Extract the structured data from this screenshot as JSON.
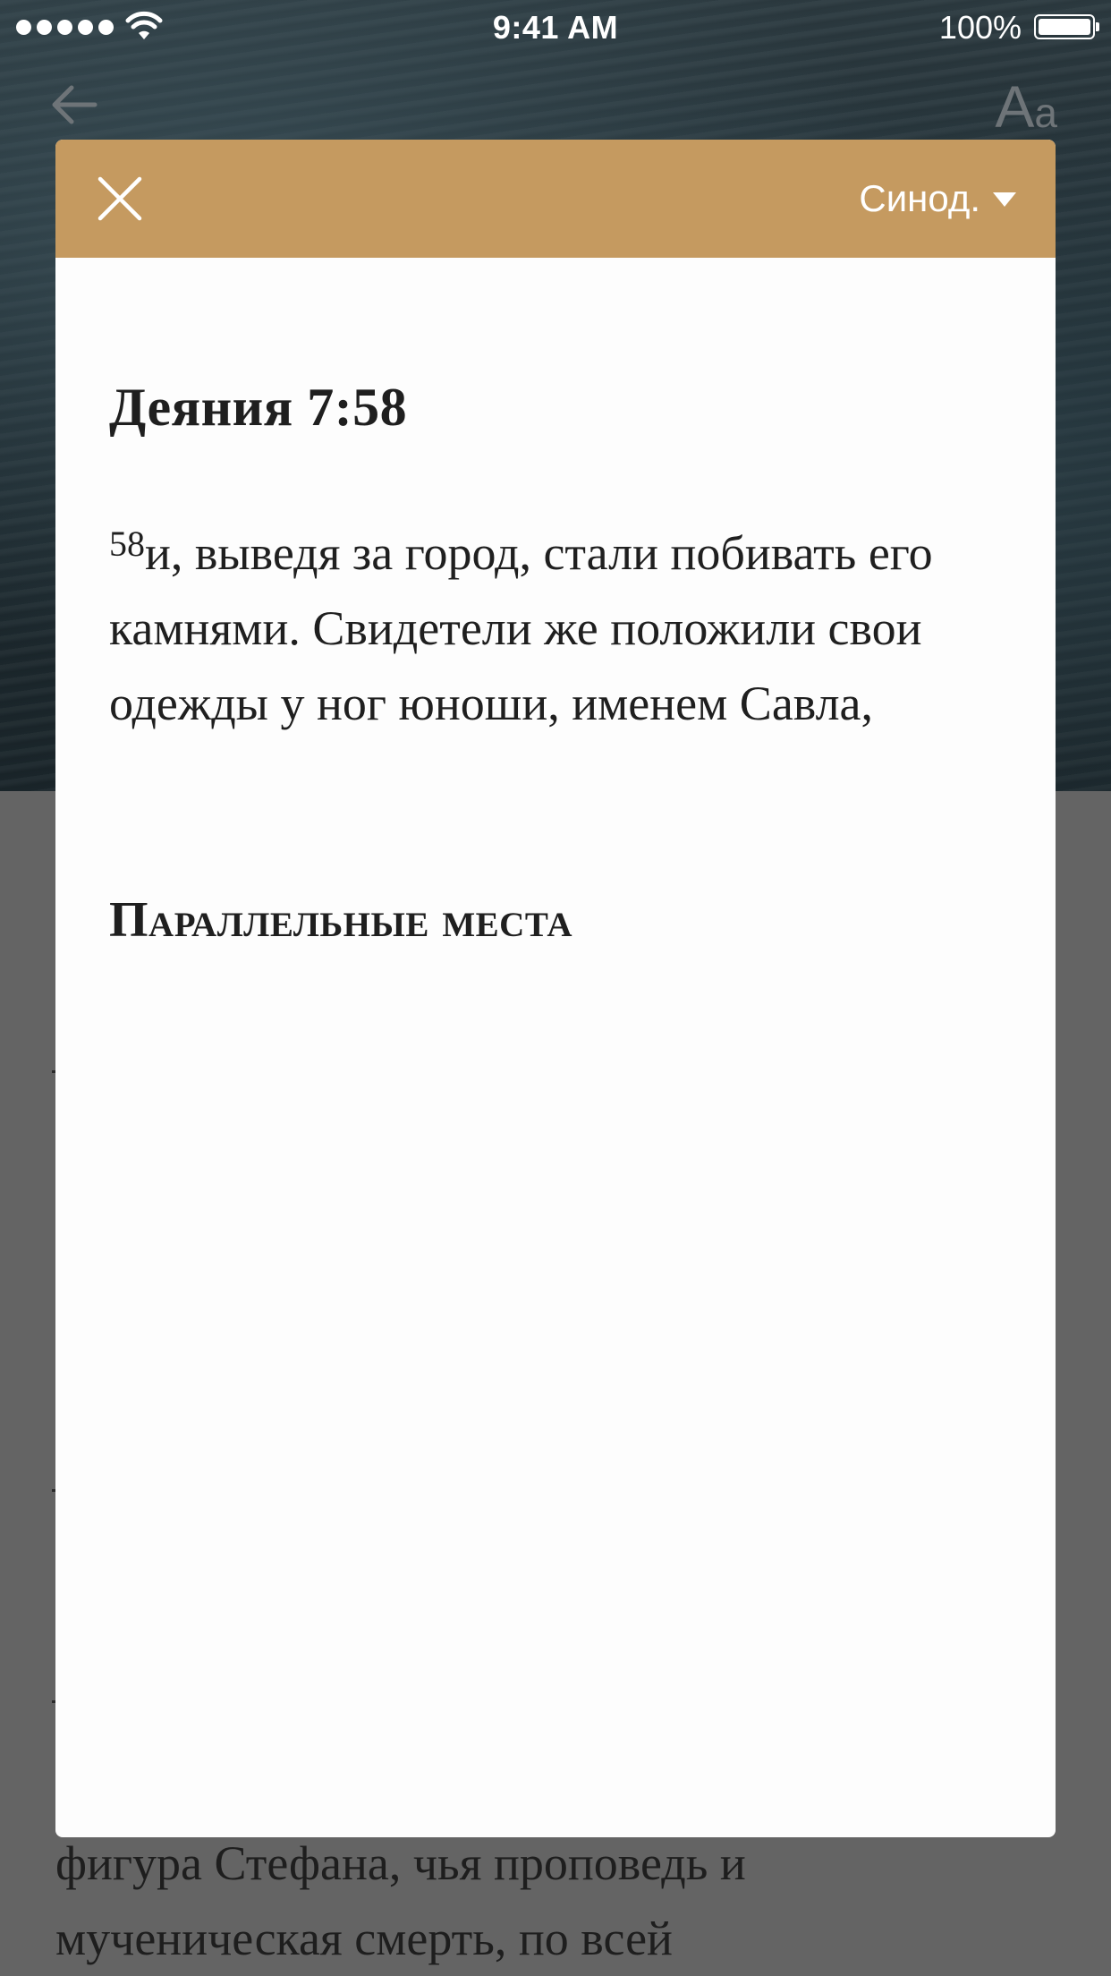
{
  "status_bar": {
    "time": "9:41 AM",
    "battery": "100%"
  },
  "icons": {
    "back": "arrow-left-icon",
    "font_size": "font-size-icon",
    "close": "close-icon",
    "dropdown": "caret-down-icon",
    "wifi": "wifi-icon",
    "signal": "signal-icon",
    "battery": "battery-icon"
  },
  "toolbar": {
    "font_size_big": "A",
    "font_size_small": "a"
  },
  "modal": {
    "translation": "Синод.",
    "verse_reference": "Деяния 7:58",
    "verse_number": "58",
    "verse_text": "и, выведя за город, стали побивать его камнями. Свидетели же положили свои одежды у ног юноши, именем Савла,",
    "section_title": "Параллельные места"
  },
  "background_article": {
    "line_1": "фигура Стефана, чья проповедь и",
    "line_2": "мученическая смерть, по всей"
  },
  "colors": {
    "header": "#c59a60",
    "overlay": "#646464",
    "text": "#1f1f1f"
  }
}
